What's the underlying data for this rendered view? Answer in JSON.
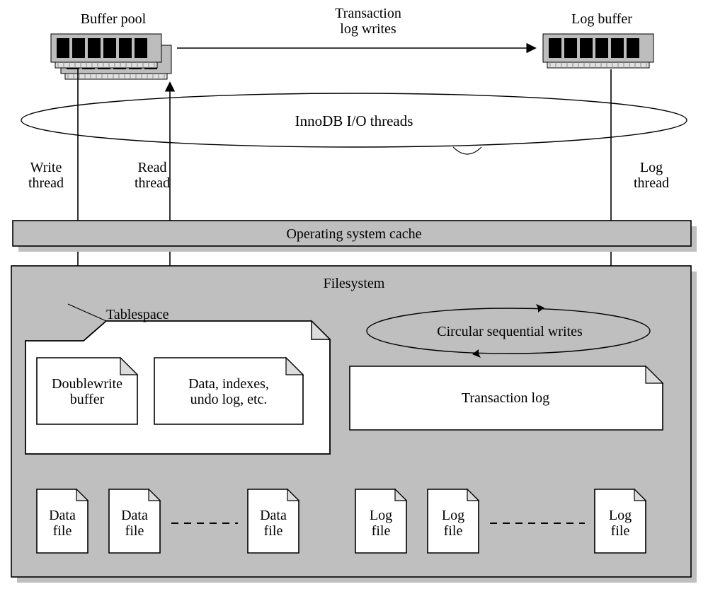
{
  "top": {
    "buffer_pool_label": "Buffer pool",
    "txn_log_writes_top": "Transaction",
    "txn_log_writes_bottom": "log writes",
    "log_buffer_label": "Log buffer"
  },
  "threads": {
    "io_threads_label": "InnoDB I/O threads",
    "write_top": "Write",
    "write_bottom": "thread",
    "read_top": "Read",
    "read_bottom": "thread",
    "log_top": "Log",
    "log_bottom": "thread"
  },
  "oscache": {
    "label": "Operating system cache"
  },
  "fs": {
    "label": "Filesystem",
    "tablespace_label": "Tablespace",
    "doublewrite_top": "Doublewrite",
    "doublewrite_bottom": "buffer",
    "data_indexes_top": "Data, indexes,",
    "data_indexes_bottom": "undo log, etc.",
    "circular_label": "Circular sequential writes",
    "txn_log_label": "Transaction log",
    "data_file_top": "Data",
    "data_file_bottom": "file",
    "log_file_top": "Log",
    "log_file_bottom": "file"
  }
}
